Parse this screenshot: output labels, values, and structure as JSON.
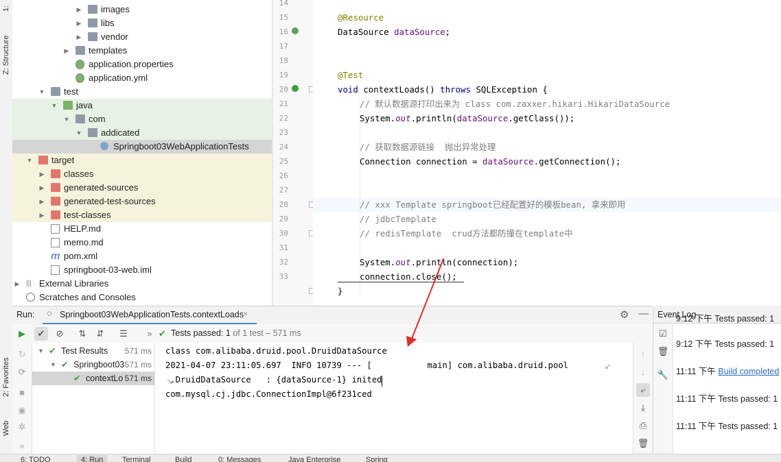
{
  "left_tool_window": {
    "structure_label": "Z: Structure",
    "favorites_label": "2: Favorites",
    "web_label": "Web",
    "project_top_label": "1:"
  },
  "project_tree": [
    {
      "label": "images",
      "kind": "folder",
      "depth": 5,
      "expanded": false
    },
    {
      "label": "libs",
      "kind": "folder",
      "depth": 5,
      "expanded": false
    },
    {
      "label": "vendor",
      "kind": "folder",
      "depth": 5,
      "expanded": false
    },
    {
      "label": "templates",
      "kind": "folder",
      "depth": 4,
      "expanded": false
    },
    {
      "label": "application.properties",
      "kind": "config",
      "depth": 4
    },
    {
      "label": "application.yml",
      "kind": "config",
      "depth": 4
    },
    {
      "label": "test",
      "kind": "folder",
      "depth": 2,
      "expanded": true
    },
    {
      "label": "java",
      "kind": "folder-green",
      "depth": 3,
      "expanded": true
    },
    {
      "label": "com",
      "kind": "package",
      "depth": 4,
      "expanded": true
    },
    {
      "label": "addicated",
      "kind": "package",
      "depth": 5,
      "expanded": true
    },
    {
      "label": "Springboot03WebApplicationTests",
      "kind": "class",
      "depth": 6,
      "selected": true
    },
    {
      "label": "target",
      "kind": "folder-red",
      "depth": 1,
      "expanded": true
    },
    {
      "label": "classes",
      "kind": "folder-red",
      "depth": 2,
      "expanded": false
    },
    {
      "label": "generated-sources",
      "kind": "folder-red",
      "depth": 2,
      "expanded": false
    },
    {
      "label": "generated-test-sources",
      "kind": "folder-red",
      "depth": 2,
      "expanded": false
    },
    {
      "label": "test-classes",
      "kind": "folder-red",
      "depth": 2,
      "expanded": false
    },
    {
      "label": "HELP.md",
      "kind": "md",
      "depth": 2
    },
    {
      "label": "memo.md",
      "kind": "md",
      "depth": 2
    },
    {
      "label": "pom.xml",
      "kind": "maven",
      "depth": 2
    },
    {
      "label": "springboot-03-web.iml",
      "kind": "iml",
      "depth": 2
    },
    {
      "label": "External Libraries",
      "kind": "lib",
      "depth": 0,
      "expanded": false
    },
    {
      "label": "Scratches and Consoles",
      "kind": "scratch",
      "depth": 0
    }
  ],
  "editor": {
    "line_numbers": [
      "14",
      "15",
      "16",
      "17",
      "18",
      "19",
      "20",
      "21",
      "22",
      "23",
      "24",
      "25",
      "26",
      "27",
      "28",
      "29",
      "30",
      "31",
      "32",
      "33"
    ],
    "lines": {
      "l14": "@Resource",
      "l15a": "DataSource ",
      "l15b": "dataSource",
      "l15c": ";",
      "l18": "@Test",
      "l19a": "void ",
      "l19b": "contextLoads() ",
      "l19c": "throws ",
      "l19d": "SQLException {",
      "l20": "// 默认数据源打印出来为 class com.zaxxer.hikari.HikariDataSource",
      "l21a": "System.",
      "l21b": "out",
      "l21c": ".println(",
      "l21d": "dataSource",
      "l21e": ".getClass());",
      "l23": "// 获取数据源链接  抛出异常处理",
      "l24a": "Connection connection = ",
      "l24b": "dataSource",
      "l24c": ".getConnection();",
      "l27": "// xxx Template springboot已经配置好的模板bean, 拿来即用",
      "l28": "// jdbcTemplate",
      "l29": "// redisTemplate  crud方法都防撞在template中",
      "l31a": "System.",
      "l31b": "out",
      "l31c": ".println(connection);",
      "l32": "connection.close();",
      "l33": "}"
    }
  },
  "run_panel": {
    "run_label": "Run:",
    "tab_label": "Springboot03WebApplicationTests.contextLoads",
    "tests_passed": "Tests passed:",
    "tests_count": "1",
    "tests_rest": "of 1 test – 571 ms",
    "results": [
      {
        "label": "Test Results",
        "time": "571 ms",
        "depth": 0
      },
      {
        "label": "Springboot03",
        "time": "571 ms",
        "depth": 1
      },
      {
        "label": "contextLo",
        "time": "571 ms",
        "depth": 2,
        "selected": true
      }
    ],
    "console_lines": [
      "class com.alibaba.druid.pool.DruidDataSource",
      "2021-04-07 23:11:05.697  INFO 10739 --- [           main] com.alibaba.druid.pool",
      " .DruidDataSource   : {dataSource-1} inited",
      "com.mysql.cj.jdbc.ConnectionImpl@6f231ced"
    ]
  },
  "event_log": {
    "title": "Event Log",
    "entries": [
      {
        "time": "9:12 下午",
        "text": "Tests passed: 1",
        "link": false
      },
      {
        "time": "9:12 下午",
        "text": "Tests passed: 1",
        "link": false
      },
      {
        "time": "11:11 下午",
        "text": "Build completed",
        "link": true
      },
      {
        "time": "11:11 下午",
        "text": "Tests passed: 1",
        "link": false
      },
      {
        "time": "11:11 下午",
        "text": "Tests passed: 1",
        "link": false
      }
    ]
  },
  "bottom_tabs": [
    "6: TODO",
    "4: Run",
    "Terminal",
    "Build",
    "0: Messages",
    "Java Enterprise",
    "Spring"
  ],
  "colors": {
    "selected_row": "#d5d5d5",
    "test_green_bg": "#e6f2e3",
    "target_yellow_bg": "#f6f3dd",
    "arrow_red": "#d8302b",
    "link_blue": "#2f6dc4",
    "pass_green": "#3a9e3a"
  }
}
